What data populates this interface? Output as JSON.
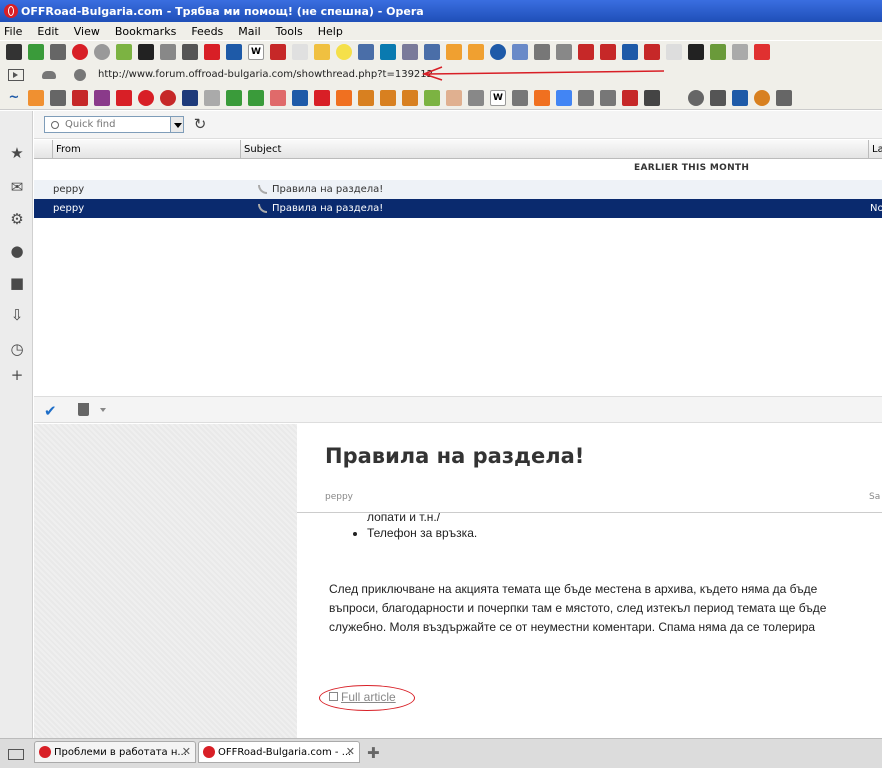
{
  "window": {
    "title": "OFFRoad-Bulgaria.com - Трябва ми помощ! (не спешна) - Opera"
  },
  "menu": [
    "File",
    "Edit",
    "View",
    "Bookmarks",
    "Feeds",
    "Mail",
    "Tools",
    "Help"
  ],
  "address": {
    "url": "http://www.forum.offroad-bulgaria.com/showthread.php?t=139212"
  },
  "quickfind": {
    "placeholder": "Quick find"
  },
  "list": {
    "columns": {
      "from": "From",
      "subject": "Subject",
      "extra": "Lal"
    },
    "group": "EARLIER THIS MONTH",
    "rows": [
      {
        "from": "peppy",
        "subject": "Правила на раздела!",
        "extra": ""
      },
      {
        "from": "peppy",
        "subject": "Правила на раздела!",
        "extra": "No"
      }
    ]
  },
  "article": {
    "title": "Правила на раздела!",
    "author": "peppy",
    "date_fragment": "Sa",
    "fragment": "лопати и т.н./",
    "bullet": "Телефон за връзка.",
    "paragraph_lines": [
      "След приключване на акцията темата ще бъде местена в архива, където няма да бъде",
      "въпроси, благодарности и почерпки там е мястото, след изтекъл период темата ще бъде",
      "служебно. Моля въздържайте се от неуместни коментари. Спама няма да се толерира"
    ],
    "full_article": "Full article"
  },
  "tabs": [
    {
      "label": "Проблеми в работата н..."
    },
    {
      "label": "OFFRoad-Bulgaria.com - ..."
    }
  ],
  "colors": {
    "selected_row": "#0a2a6e",
    "annotation_red": "#d81f26",
    "title_bar": "#2456c8"
  }
}
